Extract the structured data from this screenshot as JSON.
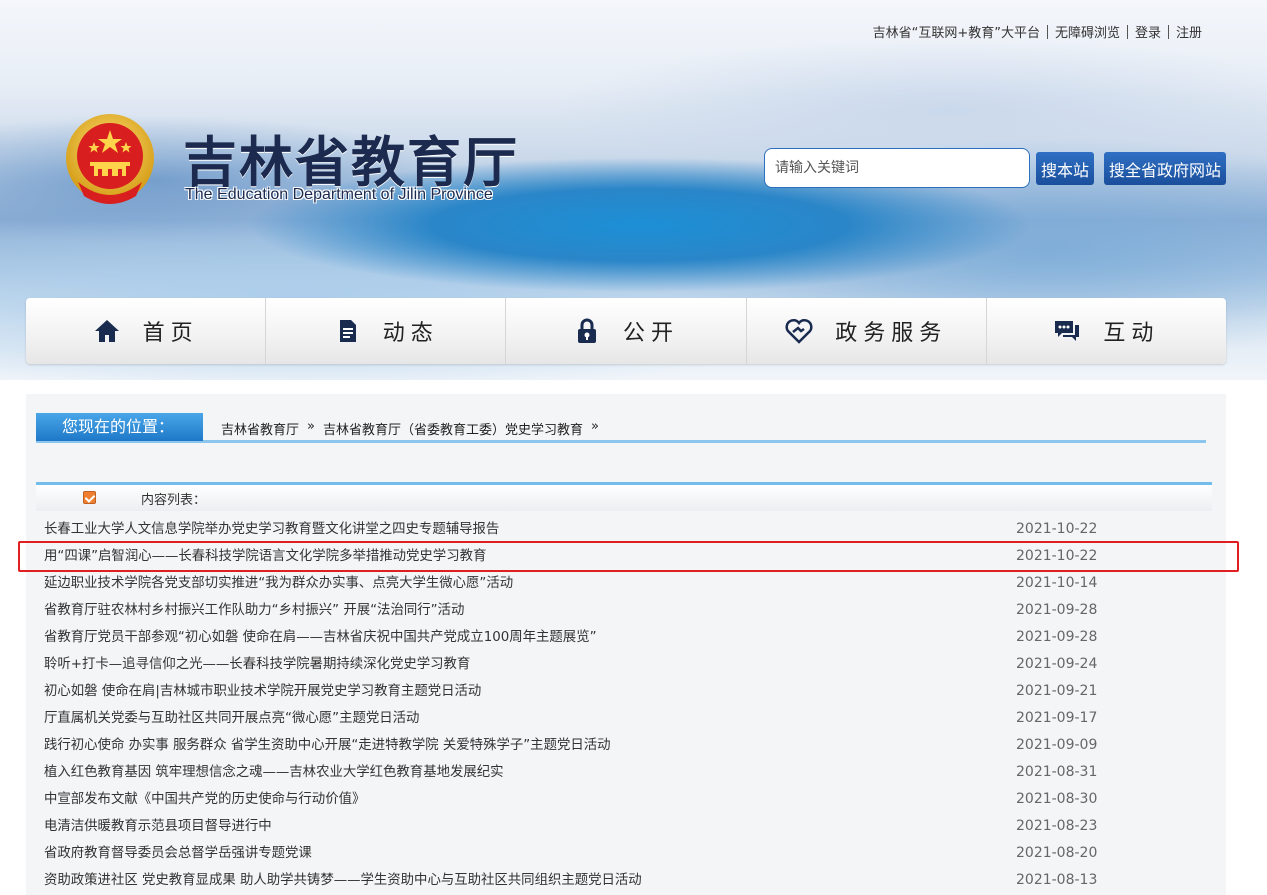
{
  "header": {
    "toplinks": [
      "吉林省“互联网+教育”大平台",
      "无障碍浏览",
      "登录",
      "注册"
    ],
    "title": "吉林省教育厅",
    "subtitle": "The Education Department of Jilin Province",
    "search_placeholder": "请输入关键词",
    "search_site_label": "搜本站",
    "search_gov_label": "搜全省政府网站"
  },
  "nav": [
    {
      "label": "首页",
      "icon": "home-icon"
    },
    {
      "label": "动态",
      "icon": "document-icon"
    },
    {
      "label": "公开",
      "icon": "lock-icon"
    },
    {
      "label": "政务服务",
      "icon": "handshake-heart-icon"
    },
    {
      "label": "互动",
      "icon": "chat-icon"
    }
  ],
  "location": {
    "label": "您现在的位置：",
    "crumbs": [
      "吉林省教育厅",
      "»",
      "吉林省教育厅（省委教育工委）党史学习教育",
      "»"
    ]
  },
  "list_title": "内容列表：",
  "articles": [
    {
      "title": "长春工业大学人文信息学院举办党史学习教育暨文化讲堂之四史专题辅导报告",
      "date": "2021-10-22"
    },
    {
      "title": "用“四课”启智润心——长春科技学院语言文化学院多举措推动党史学习教育",
      "date": "2021-10-22"
    },
    {
      "title": "延边职业技术学院各党支部切实推进“我为群众办实事、点亮大学生微心愿”活动",
      "date": "2021-10-14"
    },
    {
      "title": "省教育厅驻农林村乡村振兴工作队助力“乡村振兴” 开展“法治同行”活动",
      "date": "2021-09-28"
    },
    {
      "title": "省教育厅党员干部参观“初心如磐 使命在肩——吉林省庆祝中国共产党成立100周年主题展览”",
      "date": "2021-09-28"
    },
    {
      "title": "聆听+打卡—追寻信仰之光——长春科技学院暑期持续深化党史学习教育",
      "date": "2021-09-24"
    },
    {
      "title": "初心如磐 使命在肩|吉林城市职业技术学院开展党史学习教育主题党日活动",
      "date": "2021-09-21"
    },
    {
      "title": "厅直属机关党委与互助社区共同开展点亮“微心愿”主题党日活动",
      "date": "2021-09-17"
    },
    {
      "title": "践行初心使命 办实事 服务群众 省学生资助中心开展“走进特教学院 关爱特殊学子”主题党日活动",
      "date": "2021-09-09"
    },
    {
      "title": "植入红色教育基因 筑牢理想信念之魂——吉林农业大学红色教育基地发展纪实",
      "date": "2021-08-31"
    },
    {
      "title": "中宣部发布文献《中国共产党的历史使命与行动价值》",
      "date": "2021-08-30"
    },
    {
      "title": "电清洁供暖教育示范县项目督导进行中",
      "date": "2021-08-23"
    },
    {
      "title": "省政府教育督导委员会总督学岳强讲专题党课",
      "date": "2021-08-20"
    },
    {
      "title": "资助政策进社区 党史教育显成果 助人助学共铸梦——学生资助中心与互助社区共同组织主题党日活动",
      "date": "2021-08-13"
    }
  ],
  "colors": {
    "nav_text": "#222222",
    "location_label_bg": "#1e78c8",
    "highlight_border": "#e02020",
    "date_text": "#666666"
  }
}
